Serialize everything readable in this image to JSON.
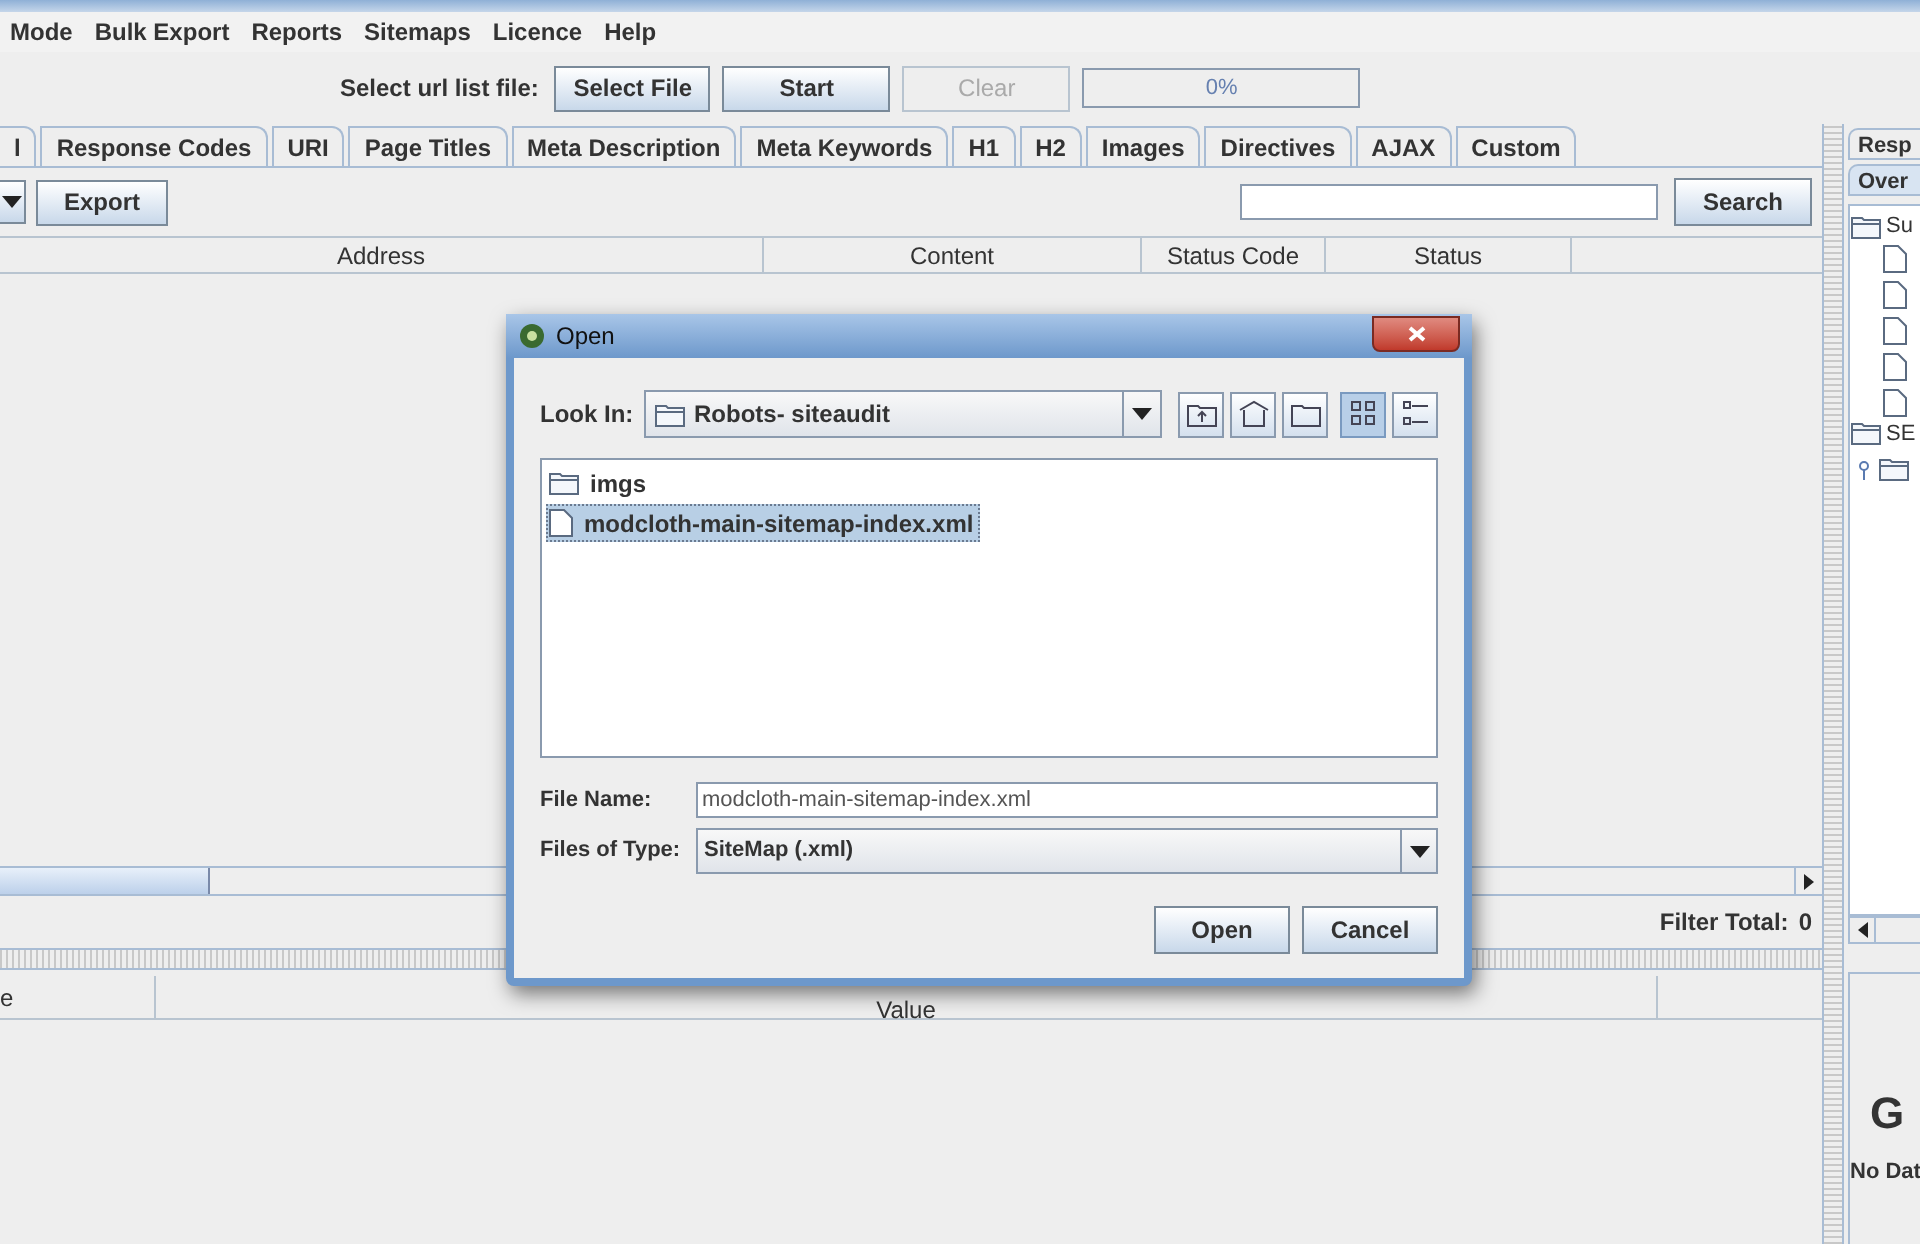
{
  "menu_bar": {
    "items": [
      "Mode",
      "Bulk Export",
      "Reports",
      "Sitemaps",
      "Licence",
      "Help"
    ]
  },
  "toolbar": {
    "label": "Select url list file:",
    "buttons": [
      {
        "label": "Select File",
        "disabled": false
      },
      {
        "label": "Start",
        "disabled": false
      },
      {
        "label": "Clear",
        "disabled": true
      }
    ],
    "progress": {
      "text": "0%",
      "level": 0
    }
  },
  "main_tabs": [
    "l",
    "Response Codes",
    "URI",
    "Page Titles",
    "Meta Description",
    "Meta Keywords",
    "H1",
    "H2",
    "Images",
    "Directives",
    "AJAX",
    "Custom"
  ],
  "filter_bar": {
    "export_button": "Export",
    "search_button": "Search"
  },
  "table": {
    "columns": [
      "Address",
      "Content",
      "Status Code",
      "Status"
    ]
  },
  "filter_total": {
    "label": "Filter Total:",
    "value": "0"
  },
  "detail_table": {
    "columns": [
      "e",
      "Value"
    ]
  },
  "side_panel": {
    "tabs": [
      "Resp",
      "Over"
    ],
    "tree": [
      {
        "label": "Su",
        "kind": "folder"
      },
      {
        "label": "SE",
        "kind": "folder"
      }
    ],
    "heading": "G",
    "text": "No Dat"
  },
  "dialog": {
    "title": "Open",
    "look_in": {
      "label": "Look In:",
      "value": "Robots- siteaudit"
    },
    "view_buttons": [
      {
        "kind": "up",
        "selected": false
      },
      {
        "kind": "home",
        "selected": false
      },
      {
        "kind": "new-folder",
        "selected": false
      },
      {
        "kind": "list",
        "selected": true
      },
      {
        "kind": "details",
        "selected": false
      }
    ],
    "files": [
      {
        "name": "imgs",
        "kind": "folder",
        "selected": false
      },
      {
        "name": "modcloth-main-sitemap-index.xml",
        "kind": "file",
        "selected": true
      }
    ],
    "file_name": {
      "label": "File Name:",
      "value": "modcloth-main-sitemap-index.xml"
    },
    "file_type": {
      "label": "Files of Type:",
      "value": "SiteMap (.xml)"
    },
    "buttons": [
      "Open",
      "Cancel"
    ]
  }
}
